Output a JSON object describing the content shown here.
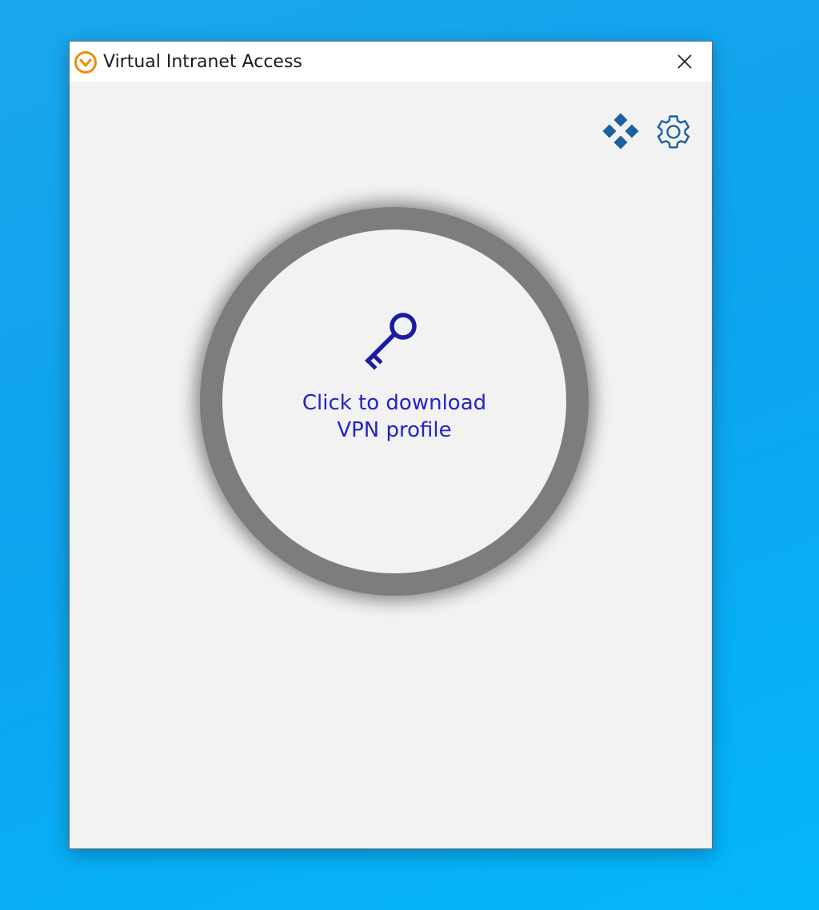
{
  "window": {
    "title": "Virtual Intranet Access",
    "app_icon": "vpn-logo-icon",
    "close_icon": "close-icon"
  },
  "toolbar": {
    "network_icon": "network-icon",
    "settings_icon": "gear-icon"
  },
  "vpn_button": {
    "icon": "key-icon",
    "label_line1": "Click to download",
    "label_line2": "VPN profile"
  },
  "colors": {
    "desktop_background": "#0ea3ee",
    "window_background": "#f2f2f2",
    "ring": "#7d7d7d",
    "accent_blue": "#2323c8",
    "icon_blue": "#1d5fa0",
    "logo_orange": "#f08a0c"
  }
}
